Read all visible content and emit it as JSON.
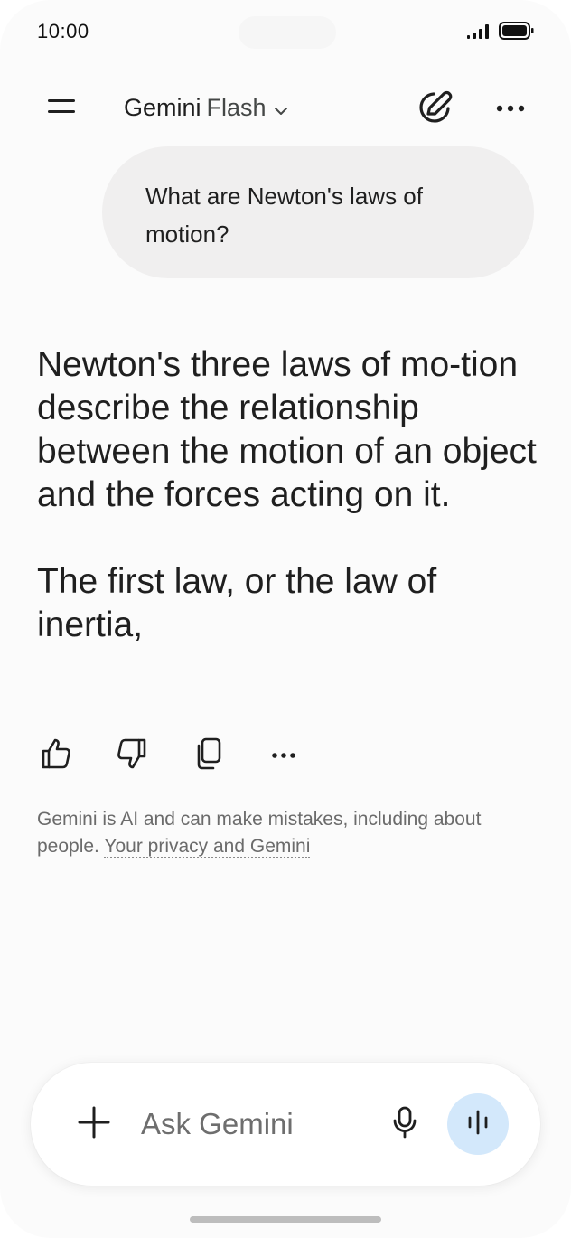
{
  "status_bar": {
    "time": "10:00"
  },
  "header": {
    "menu_icon": "hamburger-menu-icon",
    "model_name": "Gemini",
    "model_variant": "Flash",
    "dropdown_icon": "chevron-down-icon",
    "new_chat_icon": "new-chat-pen-icon",
    "more_icon": "more-horizontal-icon"
  },
  "conversation": {
    "user_message": "What are Newton's laws of motion?",
    "response_paragraphs": [
      "Newton's three laws of mo-tion describe the relationship between the motion of an object and the forces acting on it.",
      "The first law, or the law of inertia,"
    ]
  },
  "response_actions": [
    {
      "name": "thumbs-up-icon"
    },
    {
      "name": "thumbs-down-icon"
    },
    {
      "name": "copy-icon"
    },
    {
      "name": "more-horizontal-icon"
    }
  ],
  "disclaimer": {
    "text": "Gemini is AI and can make mistakes, including about people.",
    "link_text": "Your privacy and Gemini"
  },
  "composer": {
    "placeholder": "Ask Gemini",
    "add_icon": "plus-icon",
    "mic_icon": "microphone-icon",
    "live_icon": "live-waveform-icon"
  },
  "colors": {
    "background": "#fbfbfb",
    "user_bubble": "#f0efef",
    "live_button": "#d3e8fb",
    "text_primary": "#1f1f1f",
    "text_secondary": "#6b6b6b"
  }
}
